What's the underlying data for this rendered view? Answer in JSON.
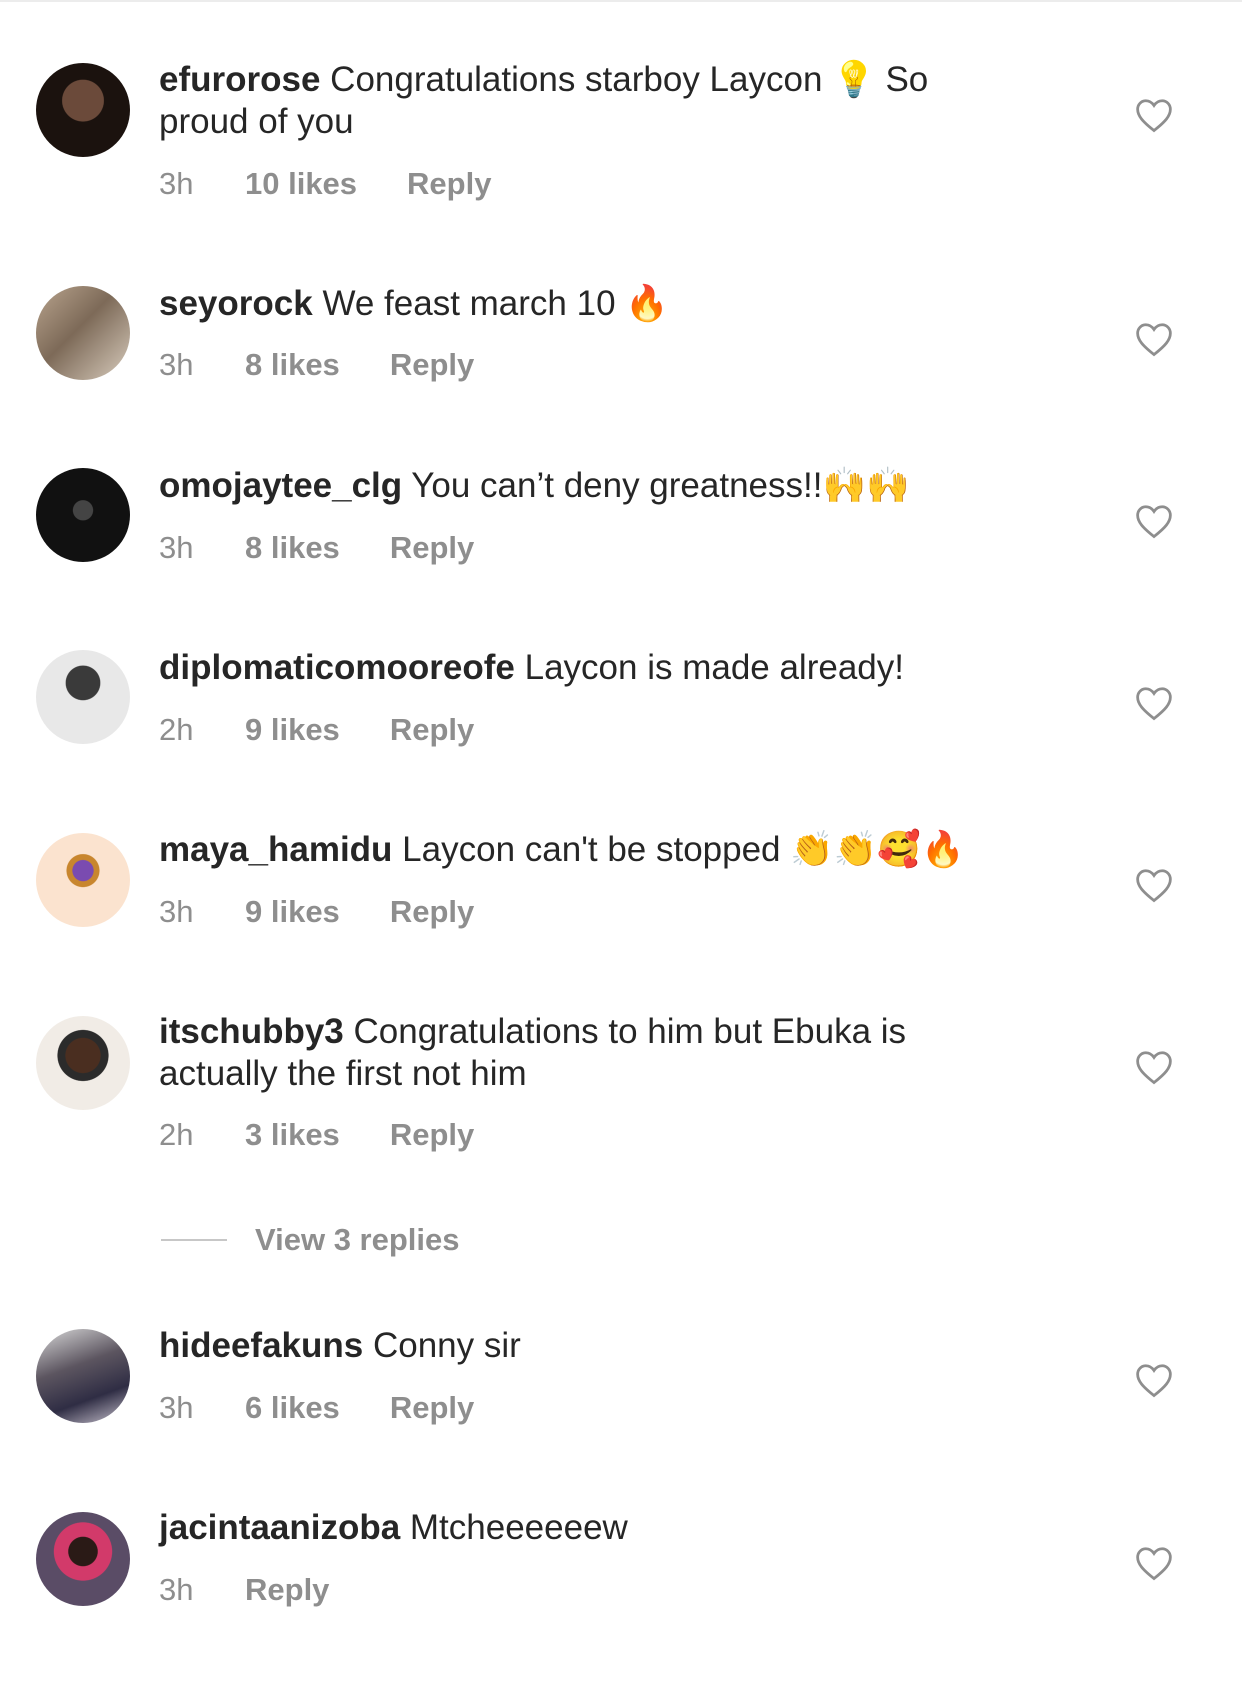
{
  "comments": [
    {
      "user": "efurorose",
      "text": "Congratulations starboy Laycon 💡 So proud of you",
      "time": "3h",
      "likes": "10 likes",
      "reply": "Reply"
    },
    {
      "user": "seyorock",
      "text": "We feast march 10 🔥",
      "time": "3h",
      "likes": "8 likes",
      "reply": "Reply"
    },
    {
      "user": "omojaytee_clg",
      "text": "You can’t deny greatness!!🙌🙌",
      "time": "3h",
      "likes": "8 likes",
      "reply": "Reply"
    },
    {
      "user": "diplomaticomooreofe",
      "text": "Laycon is made already!",
      "time": "2h",
      "likes": "9 likes",
      "reply": "Reply"
    },
    {
      "user": "maya_hamidu",
      "text": "Laycon can't be stopped 👏👏🥰🔥",
      "time": "3h",
      "likes": "9 likes",
      "reply": "Reply"
    },
    {
      "user": "itschubby3",
      "text": "Congratulations to him but Ebuka is actually the first not him",
      "time": "2h",
      "likes": "3 likes",
      "reply": "Reply"
    },
    {
      "user": "hideefakuns",
      "text": "Conny sir",
      "time": "3h",
      "likes": "6 likes",
      "reply": "Reply"
    },
    {
      "user": "jacintaanizoba",
      "text": "Mtcheeeeeew",
      "time": "3h",
      "likes": "",
      "reply": "Reply"
    }
  ],
  "view_replies": "View 3 replies",
  "colors": {
    "text": "#262626",
    "secondary": "#8e8e8e",
    "heart": "#8e8e8e",
    "background": "#ffffff"
  },
  "icons": {
    "like": "heart-outline-icon"
  }
}
